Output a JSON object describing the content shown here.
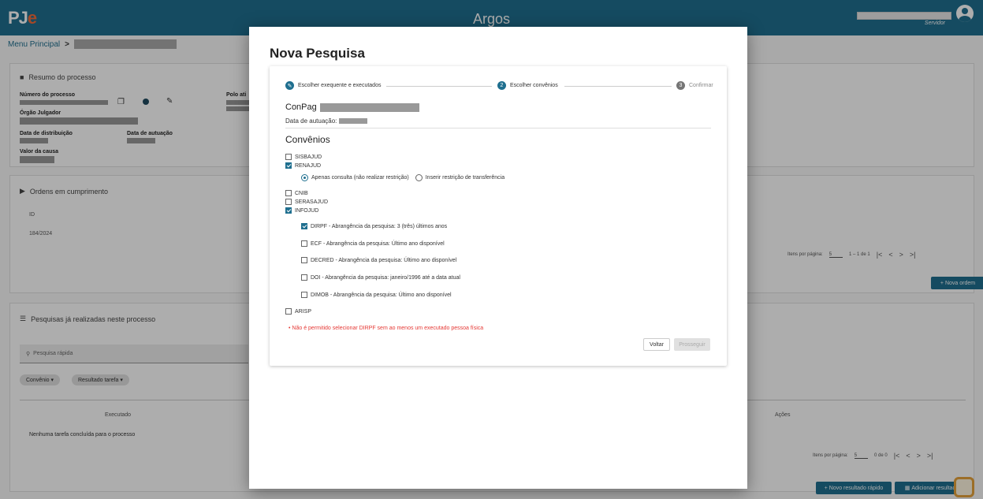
{
  "topbar": {
    "logo_main": "PJ",
    "logo_accent": "e",
    "app_title": "Argos",
    "user_role": "Servidor"
  },
  "breadcrumb": {
    "label": "Menu Principal",
    "separator": ">"
  },
  "resumo": {
    "title": "Resumo do processo",
    "numero_label": "Número do processo",
    "orgao_label": "Órgão Julgador",
    "polo_label": "Polo ati",
    "distribuicao_label": "Data de distribuição",
    "autuacao_label": "Data de autuação",
    "valor_label": "Valor da causa"
  },
  "ordens": {
    "title": "Ordens em cumprimento",
    "col_id": "ID",
    "row_id": "184/2024",
    "paginator": {
      "items_label": "Itens por página:",
      "per_page": "5",
      "range": "1 – 1 de 1"
    },
    "new_button": "Nova ordem"
  },
  "pesquisas": {
    "title": "Pesquisas já realizadas neste processo",
    "search_placeholder": "Pesquisa rápida",
    "chips": [
      "Convênio",
      "Resultado tarefa"
    ],
    "col_executado": "Executado",
    "col_acoes": "Ações",
    "empty": "Nenhuma tarefa concluída para o processo",
    "paginator": {
      "items_label": "Itens por página:",
      "per_page": "5",
      "range": "0 de 0"
    },
    "btn_rapido": "Novo resultado rápido",
    "btn_adicionar": "Adicionar resultado"
  },
  "modal": {
    "title": "Nova Pesquisa",
    "steps": [
      {
        "num": "",
        "label": "Escolher exequente e executados"
      },
      {
        "num": "2",
        "label": "Escolher convênios"
      },
      {
        "num": "3",
        "label": "Confirmar"
      }
    ],
    "conpag_label": "ConPag",
    "data_autuacao_label": "Data de autuação:",
    "convenios_title": "Convênios",
    "convenios": [
      {
        "label": "SISBAJUD",
        "checked": false
      },
      {
        "label": "RENAJUD",
        "checked": true
      },
      {
        "label": "CNIB",
        "checked": false
      },
      {
        "label": "SERASAJUD",
        "checked": false
      },
      {
        "label": "INFOJUD",
        "checked": true
      },
      {
        "label": "ARISP",
        "checked": false
      }
    ],
    "renajud_options": [
      "Apenas consulta (não realizar restrição)",
      "Inserir restrição de transferência"
    ],
    "infojud_options": [
      {
        "label": "DIRPF - Abrangência da pesquisa: 3 (três) últimos anos",
        "checked": true
      },
      {
        "label": "ECF - Abrangência da pesquisa: Último ano disponível",
        "checked": false
      },
      {
        "label": "DECRED - Abrangência da pesquisa: Último ano disponível",
        "checked": false
      },
      {
        "label": "DOI - Abrangência da pesquisa: janeiro/1996 até a data atual",
        "checked": false
      },
      {
        "label": "DIMOB - Abrangência da pesquisa: Último ano disponível",
        "checked": false
      }
    ],
    "error": "Não é permitido selecionar DIRPF sem ao menos um executado pessoa física",
    "btn_voltar": "Voltar",
    "btn_prosseguir": "Prosseguir"
  }
}
